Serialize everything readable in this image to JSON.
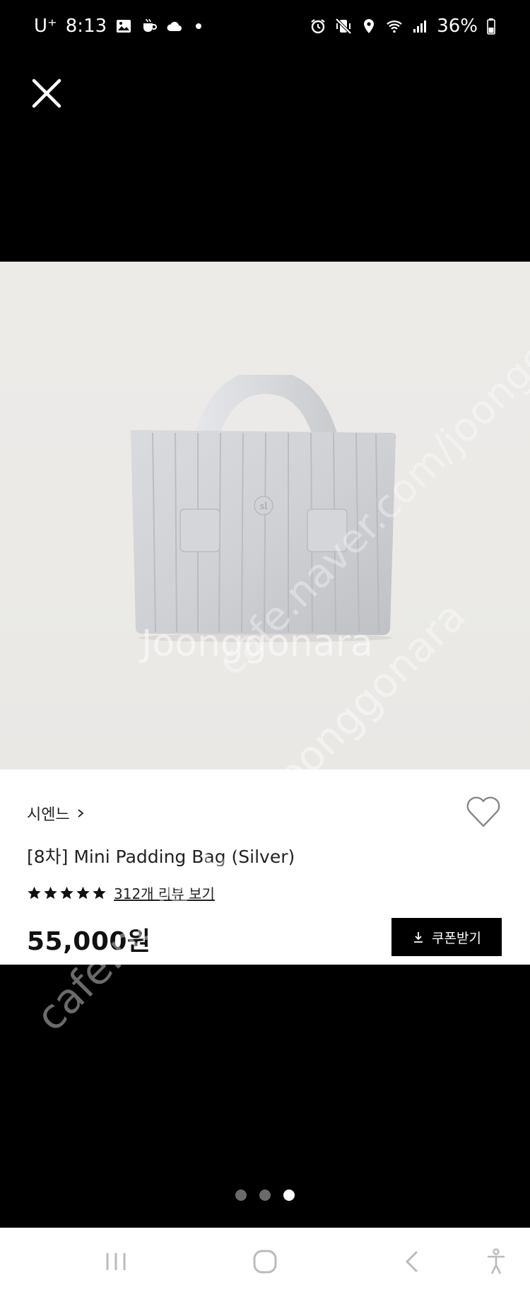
{
  "status_bar": {
    "carrier": "U⁺",
    "time": "8:13",
    "battery": "36%"
  },
  "product": {
    "brand": "시엔느",
    "title": "[8차] Mini Padding Bag (Silver)",
    "rating": 5,
    "review_link": "312개 리뷰 보기",
    "price": "55,000원",
    "coupon_label": "쿠폰받기",
    "bag_logo": "sl"
  },
  "carousel": {
    "count": 3,
    "active_index": 2
  },
  "watermark": {
    "text_1": "cafe.naver.com/joonggonara",
    "text_2": "Joonggonara"
  },
  "colors": {
    "background": "#000000",
    "panel": "#ffffff",
    "image_bg": "#ebeae7",
    "accent": "#000000"
  }
}
